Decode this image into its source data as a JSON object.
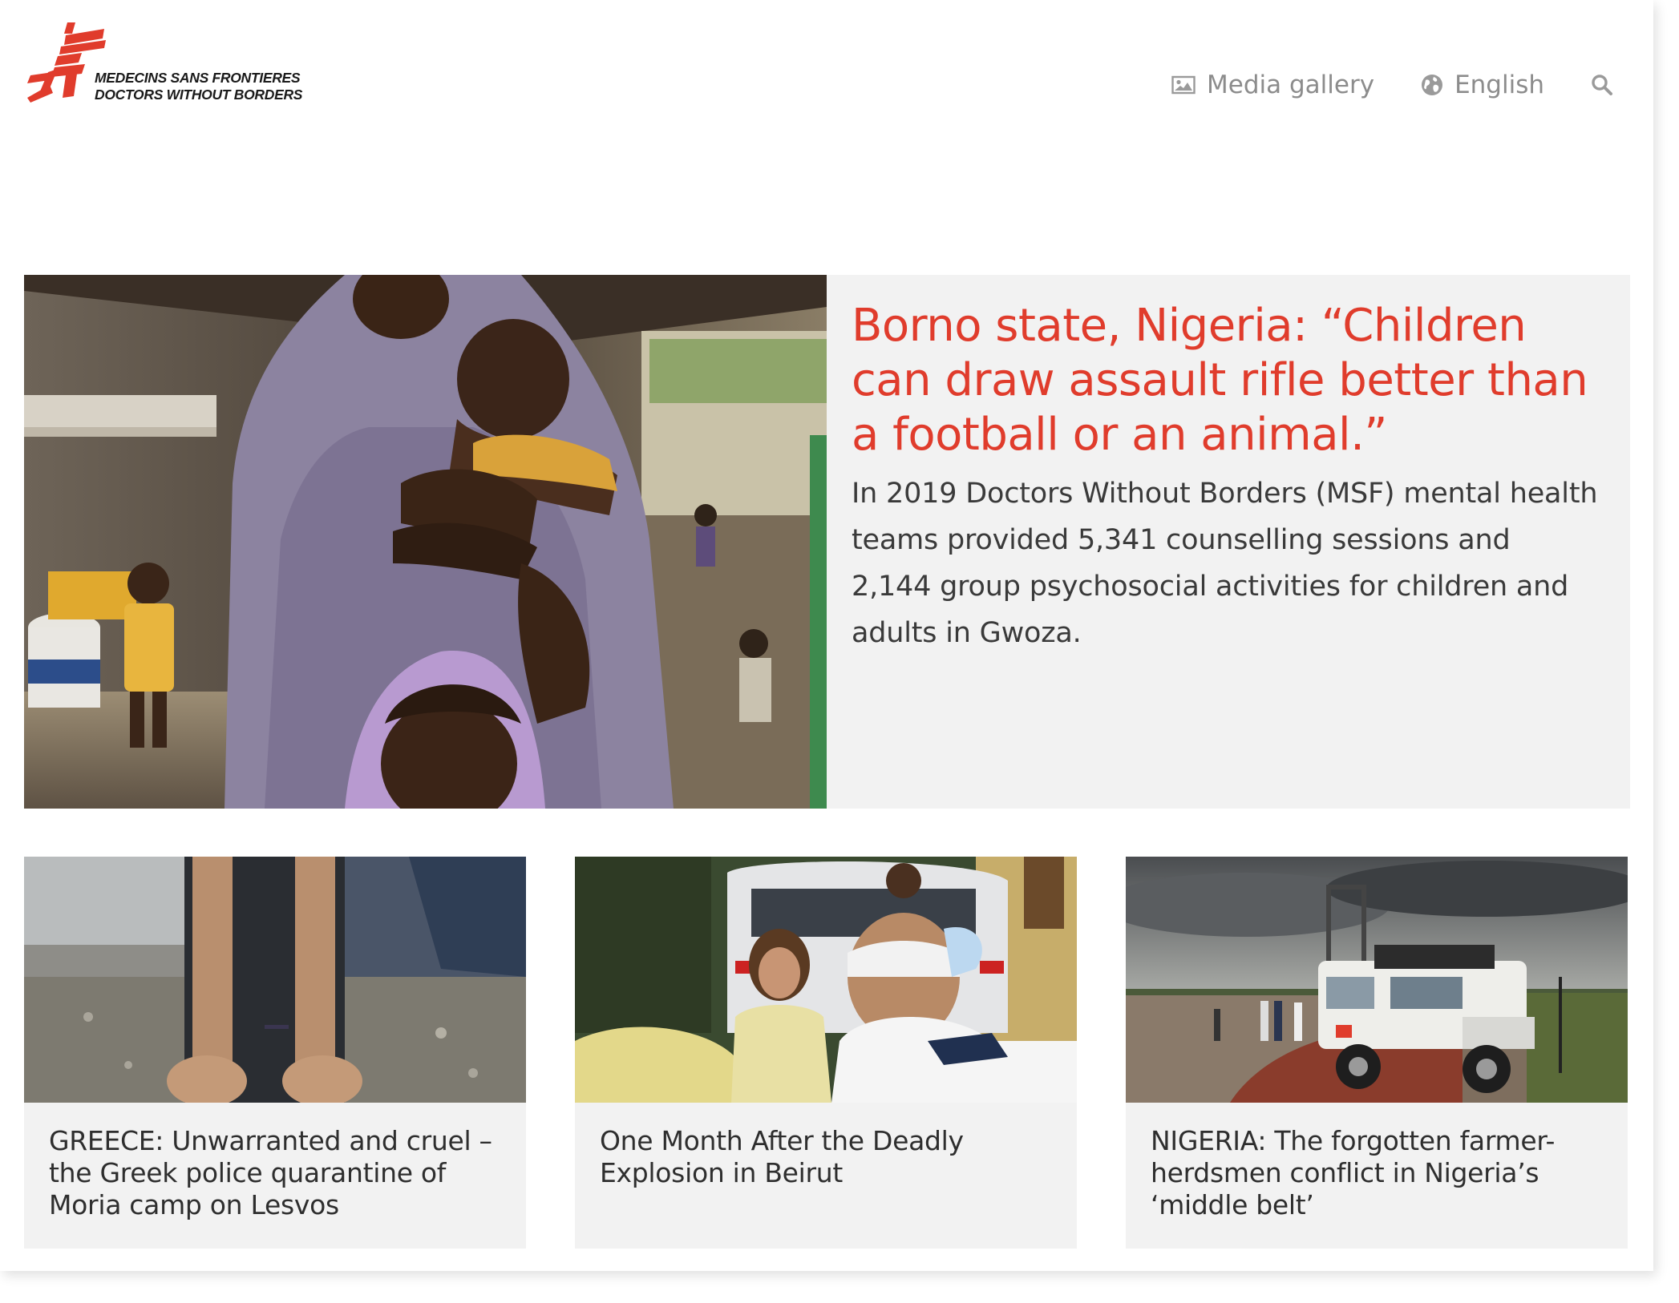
{
  "header": {
    "logo": {
      "line1": "MEDECINS SANS FRONTIERES",
      "line2": "DOCTORS WITHOUT BORDERS",
      "brand_color": "#e03c2c"
    },
    "nav": [
      {
        "label": "Media gallery",
        "icon": "image-icon"
      },
      {
        "label": "English",
        "icon": "globe-icon"
      },
      {
        "label": "",
        "icon": "search-icon"
      }
    ]
  },
  "featured": {
    "title": "Borno state, Nigeria: “Children can draw assault rifle better than a football or an animal.”",
    "summary": "In 2019 Doctors Without Borders (MSF) mental health teams provided 5,341 counselling sessions and 2,144 group psychosocial activities for children and adults in Gwoza.",
    "image_alt": "photo-mother-and-children"
  },
  "cards": [
    {
      "title": "GREECE: Unwarranted and cruel – the Greek police quarantine of Moria camp on Lesvos"
    },
    {
      "title": "One Month After the Deadly Explosion in Beirut"
    },
    {
      "title": "NIGERIA: The forgotten farmer-herdsmen conflict in Nigeria’s ‘middle belt’"
    }
  ],
  "colors": {
    "accent": "#e03c2c",
    "nav_text": "#8c8c8c",
    "card_bg": "#f2f2f2",
    "body_text": "#3a3a3a"
  }
}
